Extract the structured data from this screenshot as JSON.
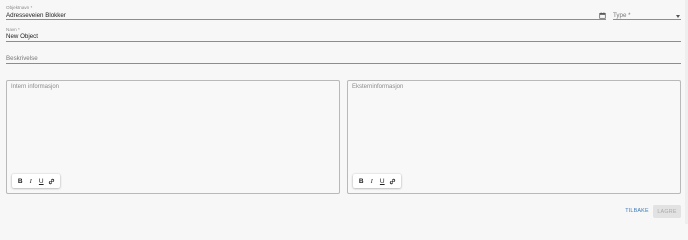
{
  "form": {
    "object_field": {
      "label": "Objektnavn *",
      "value": "Adresseveien Blokker"
    },
    "type_field": {
      "placeholder": "Type *"
    },
    "name_field": {
      "label": "Navn *",
      "value": "New Object"
    },
    "description_field": {
      "placeholder": "Beskrivelse"
    }
  },
  "editors": {
    "intern": {
      "placeholder": "Intern informasjon"
    },
    "ekstern": {
      "placeholder": "Eksterninformasjon"
    },
    "toolbar": {
      "bold": "B",
      "italic": "I",
      "underline": "U"
    }
  },
  "actions": {
    "back_label": "TILBAKE",
    "save_label": "LAGRE"
  },
  "icons": {
    "calendar": "calendar-icon",
    "caret": "chevron-down-icon",
    "link": "link-icon"
  },
  "colors": {
    "link_accent": "#3a7ab8",
    "disabled_bg": "#e2e2e2"
  }
}
